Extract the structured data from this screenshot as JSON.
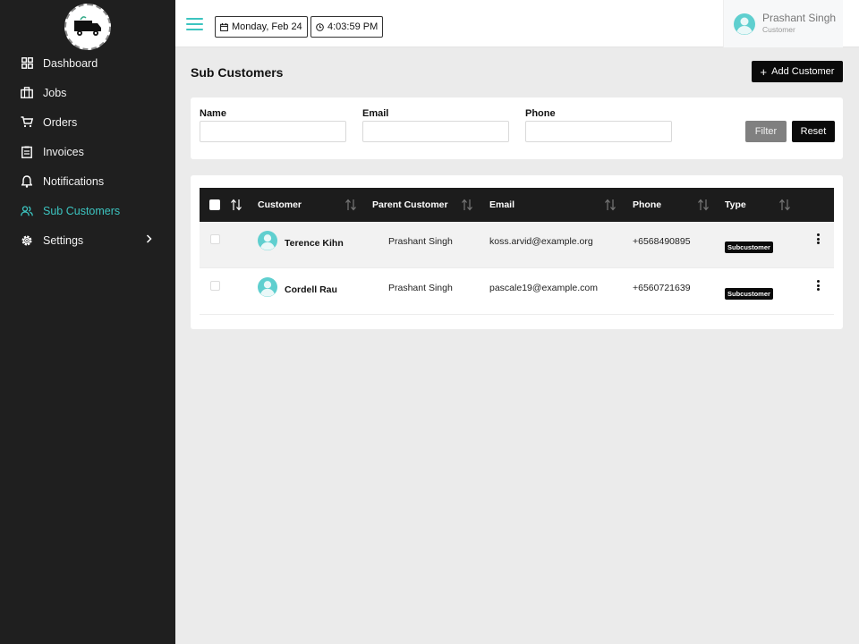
{
  "sidebar": {
    "items": [
      {
        "label": "Dashboard",
        "icon": "dashboard-icon"
      },
      {
        "label": "Jobs",
        "icon": "briefcase-icon"
      },
      {
        "label": "Orders",
        "icon": "cart-icon"
      },
      {
        "label": "Invoices",
        "icon": "invoice-icon"
      },
      {
        "label": "Notifications",
        "icon": "bell-icon"
      },
      {
        "label": "Sub Customers",
        "icon": "users-icon",
        "active": true
      },
      {
        "label": "Settings",
        "icon": "gear-icon"
      }
    ]
  },
  "topbar": {
    "date": "Monday, Feb 24",
    "time": "4:03:59 PM",
    "user_name": "Prashant Singh",
    "user_role": "Customer"
  },
  "page": {
    "title": "Sub Customers",
    "add_button": "Add Customer"
  },
  "filters": {
    "name_label": "Name",
    "email_label": "Email",
    "phone_label": "Phone",
    "name_value": "",
    "email_value": "",
    "phone_value": "",
    "filter_button": "Filter",
    "reset_button": "Reset"
  },
  "table": {
    "columns": [
      "Customer",
      "Parent Customer",
      "Email",
      "Phone",
      "Type"
    ],
    "rows": [
      {
        "customer": "Terence Kihn",
        "parent": "Prashant Singh",
        "email": "koss.arvid@example.org",
        "phone": "+6568490895",
        "type": "Subcustomer"
      },
      {
        "customer": "Cordell Rau",
        "parent": "Prashant Singh",
        "email": "pascale19@example.com",
        "phone": "+6560721639",
        "type": "Subcustomer"
      }
    ]
  },
  "colors": {
    "accent": "#3cc4c0",
    "sidebar_bg": "#1f1f1f",
    "page_bg": "#ebebeb"
  }
}
